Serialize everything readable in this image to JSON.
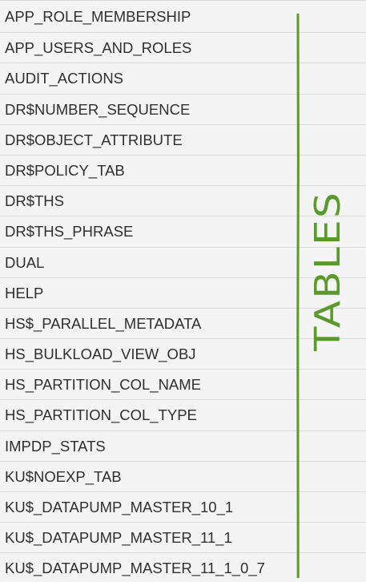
{
  "tables": [
    "APP_ROLE_MEMBERSHIP",
    "APP_USERS_AND_ROLES",
    "AUDIT_ACTIONS",
    "DR$NUMBER_SEQUENCE",
    "DR$OBJECT_ATTRIBUTE",
    "DR$POLICY_TAB",
    "DR$THS",
    "DR$THS_PHRASE",
    "DUAL",
    "HELP",
    "HS$_PARALLEL_METADATA",
    "HS_BULKLOAD_VIEW_OBJ",
    "HS_PARTITION_COL_NAME",
    "HS_PARTITION_COL_TYPE",
    "IMPDP_STATS",
    "KU$NOEXP_TAB",
    "KU$_DATAPUMP_MASTER_10_1",
    "KU$_DATAPUMP_MASTER_11_1",
    "KU$_DATAPUMP_MASTER_11_1_0_7"
  ],
  "annotation": {
    "text": "TABLES",
    "color": "#5a9a2a"
  }
}
